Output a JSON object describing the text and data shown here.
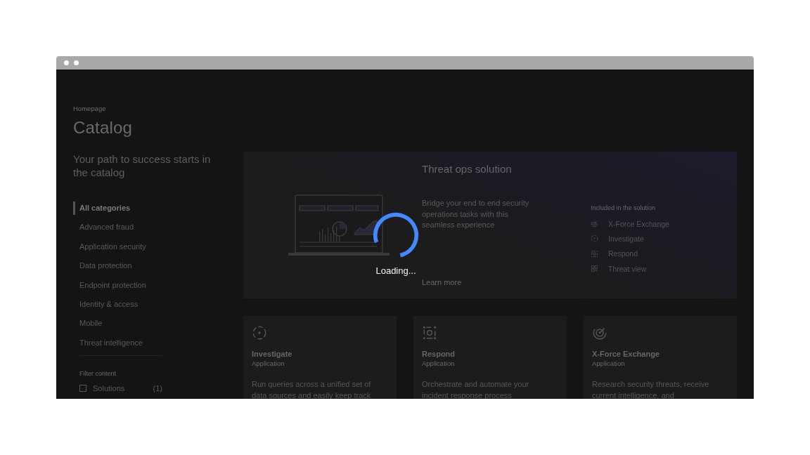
{
  "breadcrumb": "Homepage",
  "title": "Catalog",
  "subtitle": "Your path to success starts in the catalog",
  "categories": [
    {
      "label": "All categories",
      "selected": true
    },
    {
      "label": "Advanced fraud",
      "selected": false
    },
    {
      "label": "Application security",
      "selected": false
    },
    {
      "label": "Data protection",
      "selected": false
    },
    {
      "label": "Endpoint protection",
      "selected": false
    },
    {
      "label": "Identity & access",
      "selected": false
    },
    {
      "label": "Mobile",
      "selected": false
    },
    {
      "label": "Threat intelligence",
      "selected": false
    }
  ],
  "filter": {
    "title": "Filter content",
    "options": [
      {
        "label": "Solutions",
        "count": "(1)",
        "checked": false
      }
    ]
  },
  "hero": {
    "title": "Threat ops solution",
    "description": "Bridge your end to end security operations tasks with this seamless experience",
    "link": "Learn more",
    "included_title": "Included  in the solution",
    "included": [
      {
        "label": "X-Force Exchange",
        "kind": "radar"
      },
      {
        "label": "Investigate",
        "kind": "target"
      },
      {
        "label": "Respond",
        "kind": "respond"
      },
      {
        "label": "Threat view",
        "kind": "grid"
      }
    ]
  },
  "cards": [
    {
      "title": "Investigate",
      "type": "Application",
      "description": "Run queries across a unified set of data sources and easily keep track",
      "kind": "target"
    },
    {
      "title": "Respond",
      "type": "Application",
      "description": "Orchestrate and automate your incident response process",
      "kind": "respond"
    },
    {
      "title": "X-Force Exchange",
      "type": "Application",
      "description": "Research security threats, receive current intelligence, and",
      "kind": "radar"
    }
  ],
  "loading": {
    "label": "Loading..."
  }
}
